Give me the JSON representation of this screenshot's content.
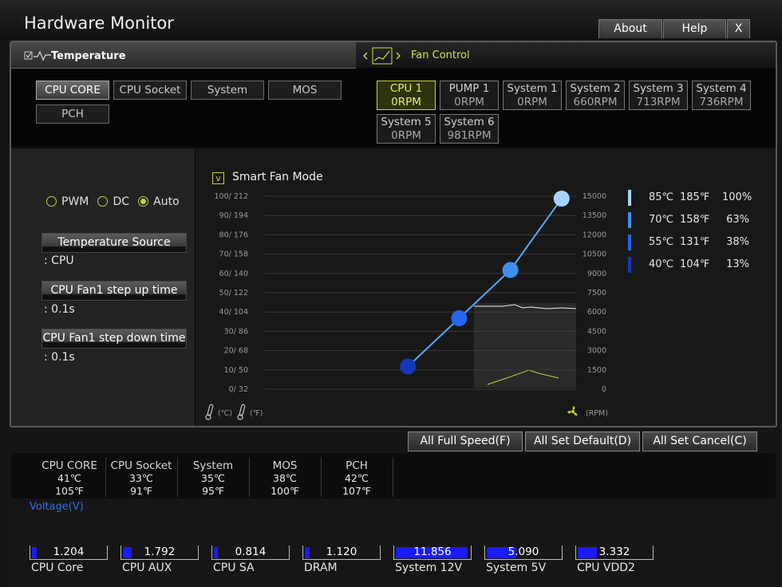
{
  "window": {
    "title": "Hardware Monitor",
    "buttons": [
      "About",
      "Help",
      "X"
    ]
  },
  "tabs": {
    "temperature": "Temperature",
    "fan_control": "Fan Control"
  },
  "temp_sources": [
    "CPU CORE",
    "CPU Socket",
    "System",
    "MOS",
    "PCH"
  ],
  "fans": [
    {
      "name": "CPU 1",
      "rpm": "0RPM"
    },
    {
      "name": "PUMP 1",
      "rpm": "0RPM"
    },
    {
      "name": "System 1",
      "rpm": "0RPM"
    },
    {
      "name": "System 2",
      "rpm": "660RPM"
    },
    {
      "name": "System 3",
      "rpm": "713RPM"
    },
    {
      "name": "System 4",
      "rpm": "736RPM"
    },
    {
      "name": "System 5",
      "rpm": "0RPM"
    },
    {
      "name": "System 6",
      "rpm": "981RPM"
    }
  ],
  "mode": {
    "options": [
      "PWM",
      "DC",
      "Auto"
    ],
    "selected": "Auto"
  },
  "settings": {
    "temp_source_label": "Temperature Source",
    "temp_source_value": ": CPU",
    "step_up_label": "CPU Fan1 step up time",
    "step_up_value": ": 0.1s",
    "step_down_label": "CPU Fan1 step down time",
    "step_down_value": ": 0.1s"
  },
  "smart_fan": {
    "label": "Smart Fan Mode",
    "checked": true,
    "check_glyph": "v"
  },
  "chart_data": {
    "type": "line",
    "left_ticks": [
      "100/ 212",
      "90/ 194",
      "80/ 176",
      "70/ 158",
      "60/ 140",
      "50/ 122",
      "40/ 104",
      "30/  86",
      "20/  68",
      "10/  50",
      "0/  32"
    ],
    "right_ticks": [
      "15000",
      "13500",
      "12000",
      "10500",
      "9000",
      "7500",
      "6000",
      "4500",
      "3000",
      "1500",
      "0"
    ],
    "points": [
      {
        "temp_c": 40,
        "speed_pct": 13
      },
      {
        "temp_c": 55,
        "speed_pct": 38
      },
      {
        "temp_c": 70,
        "speed_pct": 63
      },
      {
        "temp_c": 85,
        "speed_pct": 100
      }
    ],
    "point_colors": [
      "#1438b8",
      "#2466ee",
      "#3f90ee",
      "#a6d2ff"
    ],
    "unit_left": "(℃)",
    "unit_left2": "(℉)",
    "unit_right": "(RPM)"
  },
  "legend": [
    {
      "c": "85℃",
      "f": "185℉",
      "pct": "100%",
      "color": "#a6d2ff"
    },
    {
      "c": "70℃",
      "f": "158℉",
      "pct": "63%",
      "color": "#3f90ee"
    },
    {
      "c": "55℃",
      "f": "131℉",
      "pct": "38%",
      "color": "#2466ee"
    },
    {
      "c": "40℃",
      "f": "104℉",
      "pct": "13%",
      "color": "#1438b8"
    }
  ],
  "actions": [
    "All Full Speed(F)",
    "All Set Default(D)",
    "All Set Cancel(C)"
  ],
  "sensor_temps": [
    {
      "name": "CPU CORE",
      "c": "41℃",
      "f": "105℉"
    },
    {
      "name": "CPU Socket",
      "c": "33℃",
      "f": "91℉"
    },
    {
      "name": "System",
      "c": "35℃",
      "f": "95℉"
    },
    {
      "name": "MOS",
      "c": "38℃",
      "f": "100℉"
    },
    {
      "name": "PCH",
      "c": "42℃",
      "f": "107℉"
    }
  ],
  "voltage_title": "Voltage(V)",
  "voltages": [
    {
      "name": "CPU Core",
      "value": "1.204",
      "level": 0.06
    },
    {
      "name": "CPU AUX",
      "value": "1.792",
      "level": 0.12
    },
    {
      "name": "CPU SA",
      "value": "0.814",
      "level": 0.05
    },
    {
      "name": "DRAM",
      "value": "1.120",
      "level": 0.06
    },
    {
      "name": "System 12V",
      "value": "11.856",
      "level": 0.98
    },
    {
      "name": "System 5V",
      "value": "5.090",
      "level": 0.4
    },
    {
      "name": "CPU VDD2",
      "value": "3.332",
      "level": 0.26
    }
  ],
  "colors": {
    "accent": "#c9d23c",
    "voltage_fill": "#1a1aff",
    "curve": "#5aa8ff"
  }
}
